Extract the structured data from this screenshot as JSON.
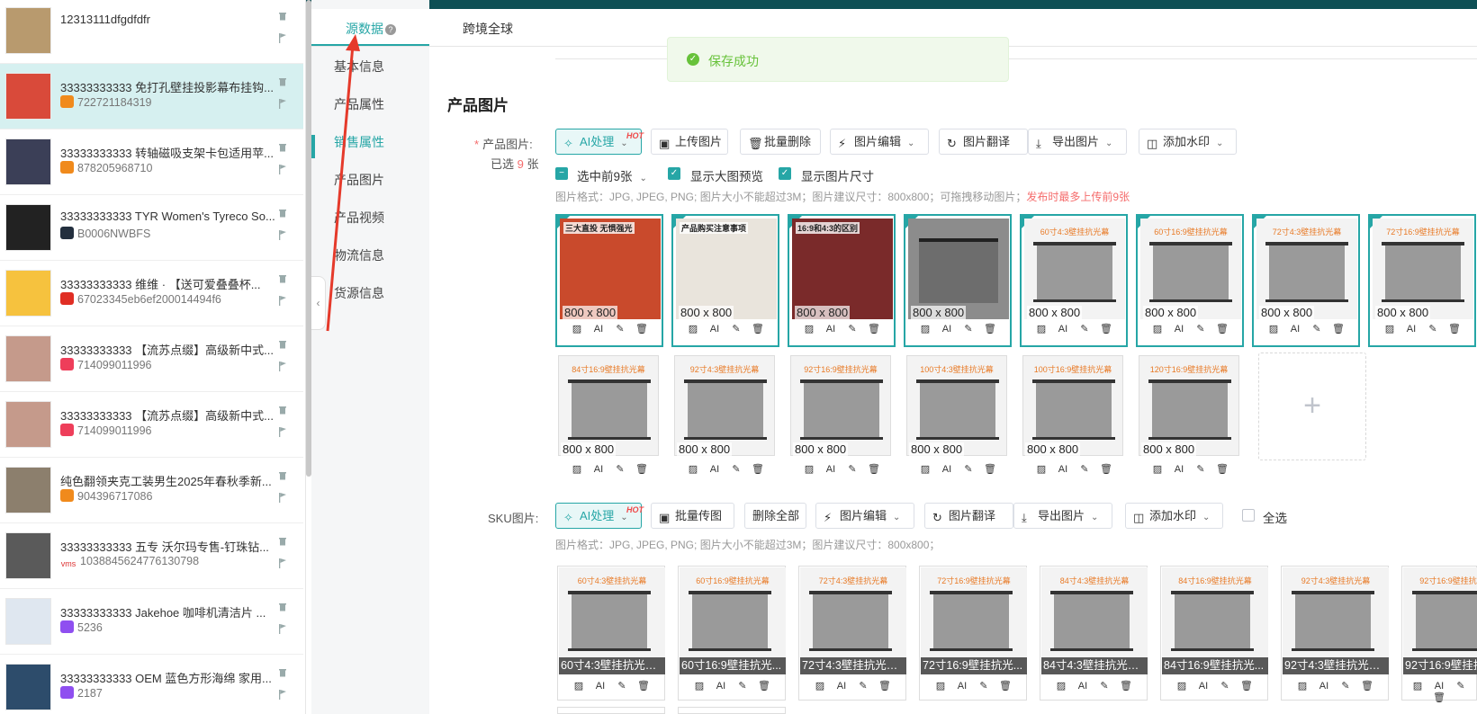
{
  "tabs": {
    "source": "源数据",
    "global": "跨境全球"
  },
  "toast": "保存成功",
  "nav": [
    "基本信息",
    "产品属性",
    "销售属性",
    "产品图片",
    "产品视频",
    "物流信息",
    "货源信息"
  ],
  "products": [
    {
      "title": "12313111dfgdfdfr",
      "sub": "",
      "badge": ""
    },
    {
      "title": "33333333333 免打孔壁挂投影幕布挂钩...",
      "sub": "722721184319",
      "badge": "1688"
    },
    {
      "title": "33333333333 转轴磁吸支架卡包适用苹...",
      "sub": "878205968710",
      "badge": "1688"
    },
    {
      "title": "33333333333 TYR Women's Tyreco So...",
      "sub": "B0006NWBFS",
      "badge": "amazon"
    },
    {
      "title": "33333333333 维维 · 【送可爱叠叠杯...",
      "sub": "67023345eb6ef200014494f6",
      "badge": "shop"
    },
    {
      "title": "33333333333 【流苏点缀】高级新中式...",
      "sub": "714099011996",
      "badge": "heart"
    },
    {
      "title": "33333333333 【流苏点缀】高级新中式...",
      "sub": "714099011996",
      "badge": "heart"
    },
    {
      "title": "纯色翻领夹克工装男生2025年春秋季新...",
      "sub": "904396717086",
      "badge": "1688"
    },
    {
      "title": "33333333333 五专 沃尔玛专售-钉珠钻...",
      "sub": "1038845624776130798",
      "badge": "vms"
    },
    {
      "title": "33333333333 Jakehoe 咖啡机清洁片 ...",
      "sub": "5236",
      "badge": "purple"
    },
    {
      "title": "33333333333 OEM 蓝色方形海绵 家用...",
      "sub": "2187",
      "badge": "purple"
    }
  ],
  "section_title": "产品图片",
  "product_images_label": "产品图片:",
  "selected_count_prefix": "已选",
  "selected_count": "9",
  "selected_count_suffix": "张",
  "toolbar": {
    "ai": "AI处理",
    "hot": "HOT",
    "upload": "上传图片",
    "batch_delete": "批量删除",
    "edit": "图片编辑",
    "translate": "图片翻译",
    "export": "导出图片",
    "watermark": "添加水印"
  },
  "checks": {
    "select_first9": "选中前9张",
    "show_preview": "显示大图预览",
    "show_size": "显示图片尺寸"
  },
  "hint1": "图片格式：JPG, JPEG, PNG; 图片大小不能超过3M；图片建议尺寸：800x800；可拖拽移动图片；",
  "hint1_red": "发布时最多上传前9张",
  "image_size": "800 x 800",
  "tool_ai": "AI",
  "row1_captions": [
    "",
    "",
    "",
    "",
    "60寸4:3壁挂抗光幕",
    "60寸16:9壁挂抗光幕",
    "72寸4:3壁挂抗光幕",
    "72寸16:9壁挂抗光幕"
  ],
  "row2_captions": [
    "84寸16:9壁挂抗光幕",
    "92寸4:3壁挂抗光幕",
    "92寸16:9壁挂抗光幕",
    "100寸4:3壁挂抗光幕",
    "100寸16:9壁挂抗光幕",
    "120寸16:9壁挂抗光幕"
  ],
  "row1_overlay": [
    "三大直投 无惧强光",
    "产品购买注意事项",
    "16:9和4:3的区别",
    ""
  ],
  "sku": {
    "label": "SKU图片:",
    "ai": "AI处理",
    "batch_upload": "批量传图",
    "delete_all": "删除全部",
    "edit": "图片编辑",
    "translate": "图片翻译",
    "export": "导出图片",
    "watermark": "添加水印",
    "select_all": "全选",
    "hint": "图片格式：JPG, JPEG, PNG; 图片大小不能超过3M；图片建议尺寸：800x800；",
    "captions": [
      "60寸4:3壁挂抗光幕",
      "60寸16:9壁挂抗光幕",
      "72寸4:3壁挂抗光幕",
      "72寸16:9壁挂抗光幕",
      "84寸4:3壁挂抗光幕",
      "84寸16:9壁挂抗光幕",
      "92寸4:3壁挂抗光幕",
      "92寸16:9壁挂抗光幕"
    ],
    "labels": [
      "60寸4:3壁挂抗光幕布",
      "60寸16:9壁挂抗光...",
      "72寸4:3壁挂抗光幕布",
      "72寸16:9壁挂抗光...",
      "84寸4:3壁挂抗光幕布",
      "84寸16:9壁挂抗光...",
      "92寸4:3壁挂抗光幕布",
      "92寸16:9壁挂抗光..."
    ]
  },
  "colors": {
    "accent": "#26a6a6",
    "hot": "#f04848",
    "success": "#67c23a"
  }
}
